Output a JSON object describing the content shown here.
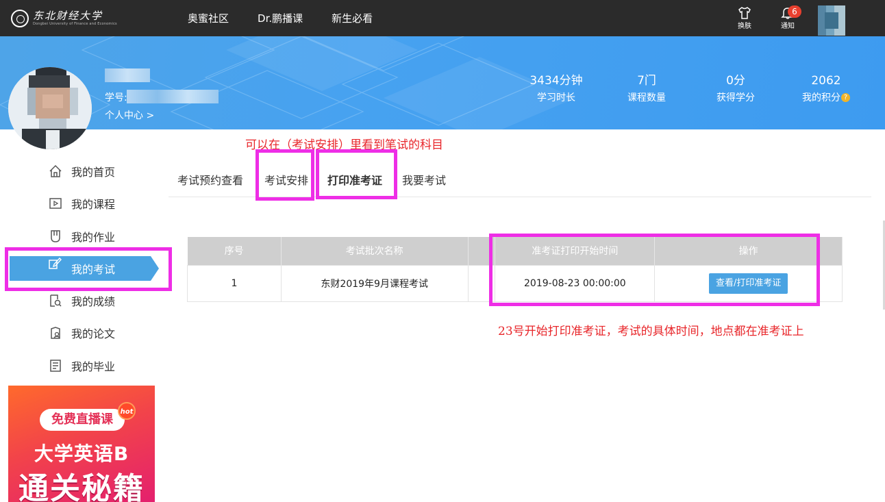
{
  "topbar": {
    "nav": [
      "奥蜜社区",
      "Dr.鹏播课",
      "新生必看"
    ],
    "skin_label": "换肤",
    "notify_label": "通知",
    "notify_count": "6"
  },
  "profile": {
    "student_id_label": "学号:",
    "center_link": "个人中心 >"
  },
  "stats": [
    {
      "value": "3434分钟",
      "label": "学习时长"
    },
    {
      "value": "7门",
      "label": "课程数量"
    },
    {
      "value": "0分",
      "label": "获得学分"
    },
    {
      "value": "2062",
      "label": "我的积分"
    }
  ],
  "sidebar": {
    "items": [
      {
        "label": "我的首页",
        "icon": "home-icon"
      },
      {
        "label": "我的课程",
        "icon": "play-square-icon"
      },
      {
        "label": "我的作业",
        "icon": "bookmark-icon"
      },
      {
        "label": "我的考试",
        "icon": "pen-paper-icon"
      },
      {
        "label": "我的成绩",
        "icon": "search-doc-icon"
      },
      {
        "label": "我的论文",
        "icon": "paper-user-icon"
      },
      {
        "label": "我的毕业",
        "icon": "certificate-icon"
      }
    ],
    "active_index": 3
  },
  "ad": {
    "pill": "免费直播课",
    "hot": "hot",
    "line1": "大学英语B",
    "line2": "通关秘籍"
  },
  "tabs": [
    "考试预约查看",
    "考试安排",
    "打印准考证",
    "我要考试"
  ],
  "active_tab": 2,
  "table": {
    "headers": [
      "序号",
      "考试批次名称",
      "",
      "准考证打印开始时间",
      "操作"
    ],
    "rows": [
      {
        "index": "1",
        "batch": "东财2019年9月课程考试",
        "blank": "",
        "start_time": "2019-08-23 00:00:00",
        "action": "查看/打印准考证"
      }
    ]
  },
  "annotations": {
    "note_top": "可以在（考试安排）里看到笔试的科目",
    "note_bottom": "23号开始打印准考证，考试的具体时间，地点都在准考证上"
  },
  "colors": {
    "topbar_bg": "#2b2b2b",
    "banner_blue": "#47a2f0",
    "active_blue": "#4aa3e2",
    "highlight_magenta": "#ee2ee6",
    "note_red": "#e8262a"
  }
}
